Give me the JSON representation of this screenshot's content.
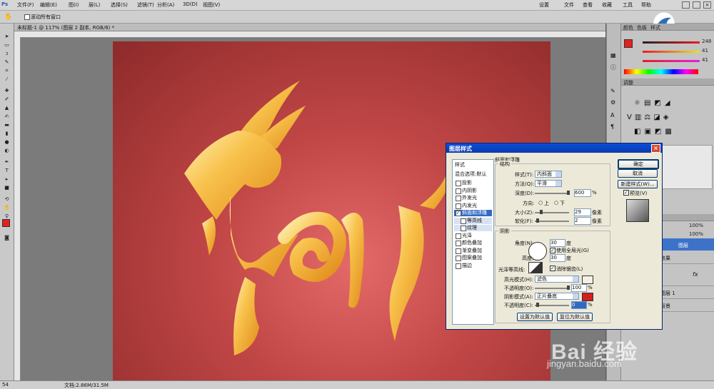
{
  "menubar": {
    "left_items": [
      "文件(F)",
      "编辑(E)",
      "图(I)",
      "层(L)",
      "选择(S)",
      "滤镜(T)",
      "分析(A)",
      "3D(D)",
      "视图(V)",
      "窗口(W)",
      "帮助(H)"
    ],
    "right_items": [
      "基本功能",
      "文件",
      "查看",
      "收藏",
      "工具",
      "帮助"
    ],
    "user_label": "设置"
  },
  "options_bar": {
    "checkbox_label": "滚动所有窗口"
  },
  "document": {
    "tab_title": "未标题-1 @ 117% (图层 2 副本, RGB/8) *",
    "zoom": "117%"
  },
  "status": {
    "zoom": "54",
    "doc_info": "文档:2.86M/31.5M"
  },
  "panels": {
    "color_tabs": [
      "颜色",
      "色板",
      "样式"
    ],
    "color_values": {
      "r": "248",
      "g": "41",
      "b": "41"
    },
    "adjust_title": "调整",
    "layers_tab": "图层",
    "layer_names": [
      "图层",
      "背景",
      "效果",
      "图层 1"
    ],
    "opacity": "100%",
    "fill": "100%",
    "fx_label": "fx"
  },
  "dialog": {
    "title": "图层样式",
    "styles_header": "样式",
    "blend_options": "混合选项:默认",
    "styles": [
      {
        "label": "投影",
        "checked": false
      },
      {
        "label": "内阴影",
        "checked": false
      },
      {
        "label": "外发光",
        "checked": false
      },
      {
        "label": "内发光",
        "checked": false
      },
      {
        "label": "斜面和浮雕",
        "checked": true,
        "selected": true
      },
      {
        "label": "等高线",
        "checked": false,
        "sub": true
      },
      {
        "label": "纹理",
        "checked": false,
        "sub": true
      },
      {
        "label": "光泽",
        "checked": false
      },
      {
        "label": "颜色叠加",
        "checked": false
      },
      {
        "label": "渐变叠加",
        "checked": false
      },
      {
        "label": "图案叠加",
        "checked": false
      },
      {
        "label": "描边",
        "checked": false
      }
    ],
    "section_bevel": "斜面和浮雕",
    "structure_title": "结构",
    "style_label": "样式(T):",
    "style_value": "内斜面",
    "technique_label": "方法(Q):",
    "technique_value": "平滑",
    "depth_label": "深度(D):",
    "depth_value": "600",
    "percent": "%",
    "direction_label": "方向:",
    "dir_up": "上",
    "dir_down": "下",
    "size_label": "大小(Z):",
    "size_value": "29",
    "px": "像素",
    "soften_label": "软化(F):",
    "soften_value": "2",
    "shading_title": "阴影",
    "angle_label": "角度(N):",
    "angle_value": "30",
    "degree": "度",
    "global_light": "使用全局光(G)",
    "altitude_label": "高度:",
    "altitude_value": "30",
    "gloss_label": "光泽等高线:",
    "anti_alias": "消除锯齿(L)",
    "highlight_label": "高光模式(H):",
    "highlight_value": "滤色",
    "hl_opacity_label": "不透明度(O):",
    "hl_opacity_value": "100",
    "shadow_label": "阴影模式(A):",
    "shadow_value": "正片叠底",
    "sh_opacity_label": "不透明度(C):",
    "sh_opacity_value": "0",
    "btn_default": "设置为默认值",
    "btn_reset": "复位为默认值",
    "btn_ok": "确定",
    "btn_cancel": "取消",
    "btn_new_style": "新建样式(W)...",
    "preview_label": "预览(V)",
    "colors": {
      "highlight": "#f4f0e6",
      "shadow": "#d32020"
    }
  },
  "watermark": {
    "main": "Bai 经验",
    "sub": "jingyan.baidu.com"
  }
}
